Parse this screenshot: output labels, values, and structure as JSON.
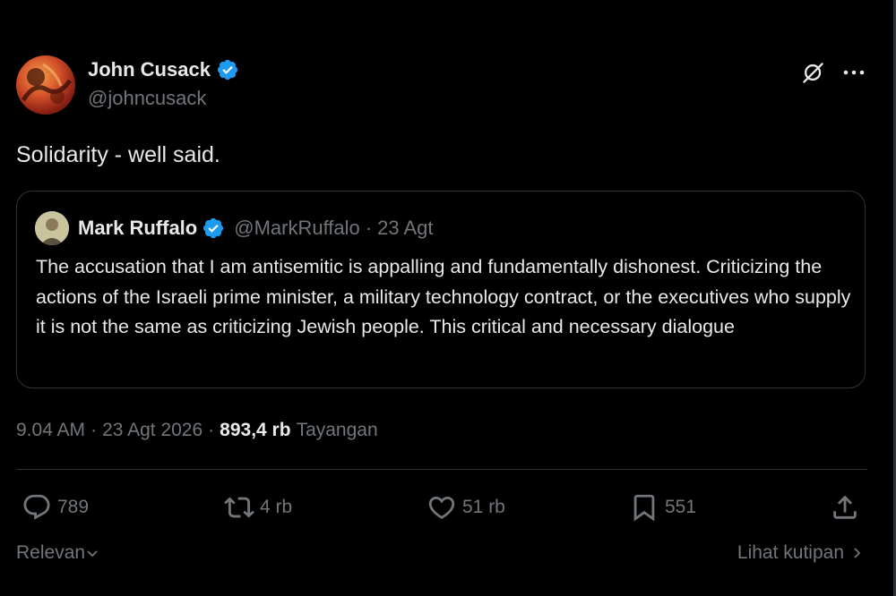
{
  "tweet": {
    "author": {
      "name": "John Cusack",
      "handle": "@johncusack",
      "verified": true,
      "avatar_icon": "profile-avatar"
    },
    "text": "Solidarity - well said.",
    "quoted": {
      "name": "Mark Ruffalo",
      "handle": "@MarkRuffalo",
      "separator": "·",
      "date": "23 Agt",
      "verified": true,
      "text": "The accusation that I am antisemitic is appalling and fundamentally dishonest. Criticizing the actions of the Israeli prime minister, a military technology contract, or the executives who supply it is not the same as criticizing Jewish people. This critical and necessary dialogue"
    },
    "meta": {
      "time": "9.04 AM",
      "separator": "·",
      "date": "23 Agt 2026",
      "views_count": "893,4 rb",
      "views_label": "Tayangan"
    },
    "actions": {
      "replies": "789",
      "reposts": "4 rb",
      "likes": "51 rb",
      "bookmarks": "551"
    },
    "footer": {
      "sort_label": "Relevan",
      "quotes_link": "Lihat kutipan"
    }
  },
  "colors": {
    "background": "#000000",
    "text_primary": "#e7e9ea",
    "text_secondary": "#71767b",
    "border": "#2f3336",
    "verified_blue": "#1d9bf0"
  }
}
